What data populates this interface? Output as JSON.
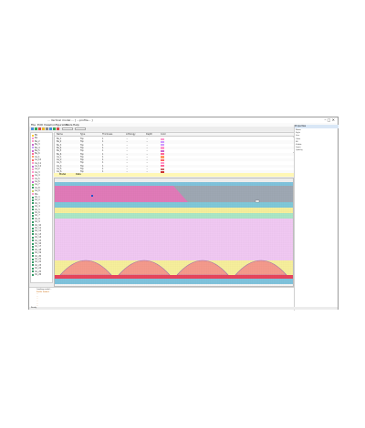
{
  "window": {
    "title": "... Vertical model ... [ ...profile... ]",
    "menu": [
      "File",
      "Edit",
      "View",
      "Configuration",
      "Tools",
      "Help"
    ]
  },
  "left_panel": {
    "items": [
      {
        "label": "BS",
        "color": "#ffcc33"
      },
      {
        "label": "Ba",
        "color": "#ff99cc"
      },
      {
        "label": "Ba_2",
        "color": "#ff99cc"
      },
      {
        "label": "Ba_3",
        "color": "#cc66cc"
      },
      {
        "label": "Ba_4",
        "color": "#cc99ff"
      },
      {
        "label": "Ba_5",
        "color": "#cc66cc"
      },
      {
        "label": "Ba_6",
        "color": "#ff6699"
      },
      {
        "label": "Ca_1",
        "color": "#ff9966"
      },
      {
        "label": "Ca_10",
        "color": "#ff6666"
      },
      {
        "label": "Ca_11",
        "color": "#ff99cc"
      },
      {
        "label": "Ca_12",
        "color": "#cc66cc"
      },
      {
        "label": "Ca_2",
        "color": "#ff99cc"
      },
      {
        "label": "Ca_3",
        "color": "#ff99cc"
      },
      {
        "label": "Ca_4",
        "color": "#ff6699"
      },
      {
        "label": "Ca_5",
        "color": "#ff99cc"
      },
      {
        "label": "Ca_6",
        "color": "#cc66cc"
      },
      {
        "label": "Ca_7",
        "color": "#66cc66"
      },
      {
        "label": "Ca_8",
        "color": "#339966"
      },
      {
        "label": "Ca_9",
        "color": "#cccc66"
      },
      {
        "label": "Ma",
        "color": "#ff99cc"
      },
      {
        "label": "Cb_1",
        "color": "#339966"
      },
      {
        "label": "Cb_2",
        "color": "#339966"
      },
      {
        "label": "Cb_3",
        "color": "#339966"
      },
      {
        "label": "Cb_4",
        "color": "#339966"
      },
      {
        "label": "Cb_5",
        "color": "#339966"
      },
      {
        "label": "Cb_6",
        "color": "#339966"
      },
      {
        "label": "Cb_7",
        "color": "#339966"
      },
      {
        "label": "Cb_8",
        "color": "#339966"
      },
      {
        "label": "Cb_9",
        "color": "#339966"
      },
      {
        "label": "Cb_10",
        "color": "#339966"
      },
      {
        "label": "Cb_11",
        "color": "#339966"
      },
      {
        "label": "Cb_12",
        "color": "#339966"
      },
      {
        "label": "Cb_13",
        "color": "#339966"
      },
      {
        "label": "Cb_14",
        "color": "#339966"
      },
      {
        "label": "Cb_15",
        "color": "#339966"
      },
      {
        "label": "Cb_16",
        "color": "#339966"
      },
      {
        "label": "Cb_17",
        "color": "#339966"
      },
      {
        "label": "Cb_18",
        "color": "#339966"
      },
      {
        "label": "Cb_19",
        "color": "#339966"
      },
      {
        "label": "Cb_20",
        "color": "#339966"
      },
      {
        "label": "Cb_21",
        "color": "#339966"
      },
      {
        "label": "Cb_22",
        "color": "#339966"
      },
      {
        "label": "Cb_23",
        "color": "#339966"
      },
      {
        "label": "Cb_24",
        "color": "#339966"
      },
      {
        "label": "Cb_25",
        "color": "#339966"
      },
      {
        "label": "Cb_26",
        "color": "#339966"
      }
    ]
  },
  "table": {
    "headers": [
      "Name",
      "Type",
      "Thickness",
      "Lithology",
      "Depth",
      "Color"
    ],
    "rows": [
      {
        "c": [
          "Ba_1",
          "Top",
          "1",
          "...",
          "...",
          ""
        ],
        "color": "#ff99cc"
      },
      {
        "c": [
          "Ba_2",
          "Top",
          "1",
          "...",
          "...",
          ""
        ],
        "color": "#cc99ff"
      },
      {
        "c": [
          "Ba_3",
          "Top",
          "1",
          "...",
          "...",
          ""
        ],
        "color": "#cc99ff"
      },
      {
        "c": [
          "Ba_4",
          "Top",
          "1",
          "...",
          "...",
          ""
        ],
        "color": "#ff99cc"
      },
      {
        "c": [
          "Ba_5",
          "Top",
          "1",
          "...",
          "...",
          ""
        ],
        "color": "#cc66cc"
      },
      {
        "c": [
          "Ba_6",
          "Top",
          "1",
          "...",
          "...",
          ""
        ],
        "color": "#ff6699"
      },
      {
        "c": [
          "Ca_1",
          "Top",
          "1",
          "...",
          "...",
          ""
        ],
        "color": "#ff9966"
      },
      {
        "c": [
          "Ca_2",
          "Top",
          "1",
          "...",
          "...",
          ""
        ],
        "color": "#ff6666"
      },
      {
        "c": [
          "Ca_3",
          "Top",
          "1",
          "...",
          "...",
          ""
        ],
        "color": "#ff99cc"
      },
      {
        "c": [
          "Ca_4",
          "Top",
          "1",
          "...",
          "...",
          ""
        ],
        "color": "#ff6699"
      },
      {
        "c": [
          "Ca_5",
          "Top",
          "1",
          "...",
          "...",
          ""
        ],
        "color": "#cc6666"
      },
      {
        "c": [
          "Ca_6",
          "Top",
          "1",
          "...",
          "...",
          ""
        ],
        "color": "#cc3333"
      }
    ]
  },
  "subtabs": [
    "Model",
    "Data"
  ],
  "right_panel": {
    "header": "Properties",
    "rows": [
      "Name",
      "Style",
      "Line",
      "Color",
      "Fill",
      "Visible",
      "Layer",
      "Opacity"
    ]
  },
  "log": {
    "lines": [
      {
        "text": "Loading model...",
        "color": "#333333"
      },
      {
        "text": "Profile loaded",
        "color": "#cc6600"
      },
      {
        "text": "...",
        "color": "#cc6600"
      },
      {
        "text": "...",
        "color": "#cc6600"
      },
      {
        "text": "...",
        "color": "#cc6600"
      },
      {
        "text": "...",
        "color": "#cc6600"
      },
      {
        "text": "...",
        "color": "#cc6600"
      },
      {
        "text": "...",
        "color": "#cc6600"
      }
    ]
  },
  "status": "Ready"
}
